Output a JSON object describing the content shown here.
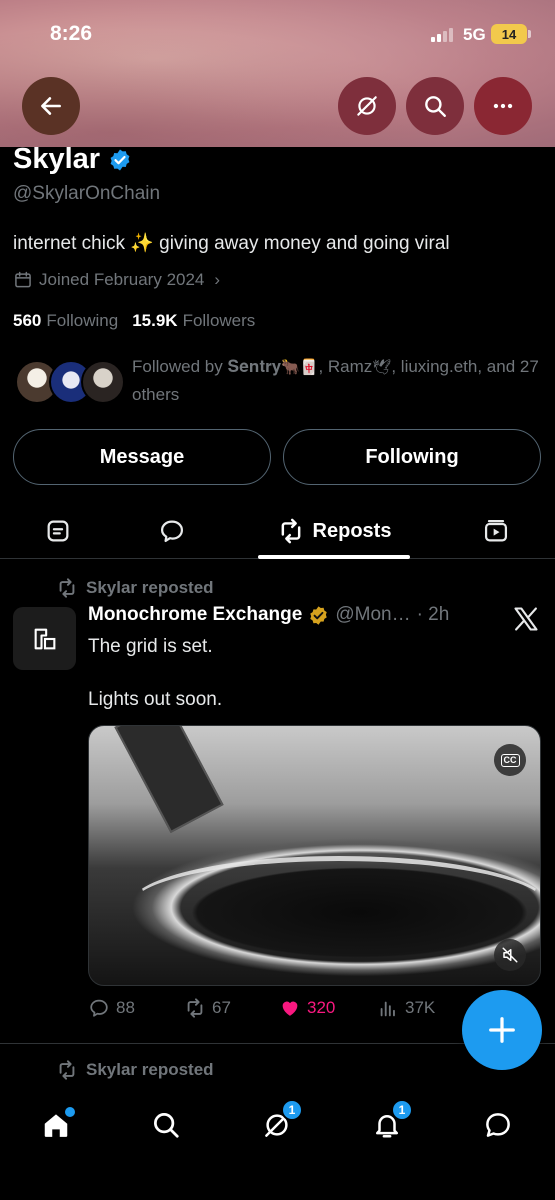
{
  "status_bar": {
    "time": "8:26",
    "network": "5G",
    "battery": "14"
  },
  "profile": {
    "name": "Skylar",
    "handle": "@SkylarOnChain",
    "bio_before": "internet chick ",
    "bio_emoji": "✨",
    "bio_after": " giving away money and going viral",
    "joined": "Joined February 2024",
    "following_count": "560",
    "following_label": "Following",
    "followers_count": "15.9K",
    "followers_label": "Followers",
    "followed_by_prefix": "Followed by ",
    "followed_by_name1": "𝐒𝐞𝐧𝐭𝐫𝐲",
    "followed_by_emoji1": "🐂🀄",
    "followed_by_name2": ", Ramz",
    "followed_by_emoji2": "🕊",
    "followed_by_rest": ", liuxing.eth, and 27 others"
  },
  "actions": {
    "message": "Message",
    "following": "Following"
  },
  "tabs": {
    "active_label": "Reposts"
  },
  "post": {
    "repost_label": "Skylar reposted",
    "author": "Monochrome Exchange",
    "handle": "@Mon…",
    "time": "· 2h",
    "text_line1": "The grid is set.",
    "text_line2": "Lights out soon.",
    "cc_label": "CC",
    "replies": "88",
    "reposts": "67",
    "likes": "320",
    "views": "37K"
  },
  "next_post": {
    "repost_label": "Skylar reposted"
  },
  "bottom_nav": {
    "grok_badge": "1",
    "notifications_badge": "1"
  },
  "colors": {
    "accent": "#1d9bf0",
    "like": "#f91880",
    "verified_gold": "#d6a21e"
  },
  "icons": [
    "back-arrow-icon",
    "grok-icon",
    "search-icon",
    "more-icon",
    "verified-icon",
    "calendar-icon",
    "repost-icon",
    "x-logo-icon",
    "cc-icon",
    "mute-icon",
    "reply-icon",
    "heart-icon",
    "views-icon",
    "compose-plus-icon",
    "home-icon",
    "bell-icon",
    "messages-icon"
  ]
}
